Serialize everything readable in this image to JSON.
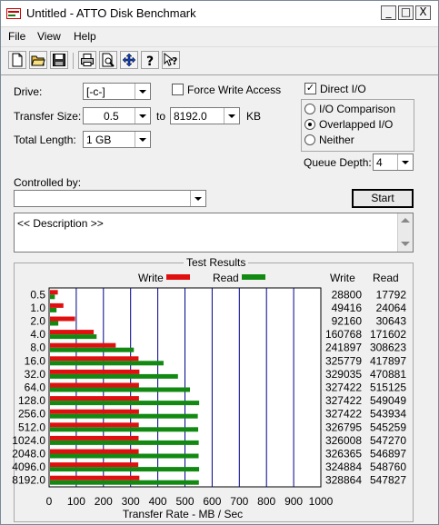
{
  "window": {
    "title": "Untitled - ATTO Disk Benchmark",
    "min": "_",
    "max": "□",
    "close": "X"
  },
  "menu": [
    "File",
    "View",
    "Help"
  ],
  "settings": {
    "drive_label": "Drive:",
    "drive_value": "[-c-]",
    "transfer_size_label": "Transfer Size:",
    "transfer_from": "0.5",
    "to_label": "to",
    "transfer_to": "8192.0",
    "kb_label": "KB",
    "total_length_label": "Total Length:",
    "total_length_value": "1 GB",
    "force_write_label": "Force Write Access",
    "force_write_checked": false,
    "direct_io_label": "Direct I/O",
    "direct_io_checked": true,
    "io_options": [
      {
        "label": "I/O Comparison",
        "selected": false
      },
      {
        "label": "Overlapped I/O",
        "selected": true
      },
      {
        "label": "Neither",
        "selected": false
      }
    ],
    "queue_depth_label": "Queue Depth:",
    "queue_depth_value": "4",
    "controlled_by_label": "Controlled by:",
    "controlled_by_value": "",
    "start_label": "Start",
    "description": "<< Description >>"
  },
  "results": {
    "group_title": "Test Results",
    "legend_write": "Write",
    "legend_read": "Read",
    "col_write": "Write",
    "col_read": "Read",
    "write_values_text": [
      "28800",
      "49416",
      "92160",
      "160768",
      "241897",
      "325779",
      "329035",
      "327422",
      "327422",
      "327422",
      "326795",
      "326008",
      "326365",
      "324884",
      "328864"
    ],
    "read_values_text": [
      "17792",
      "24064",
      "30643",
      "171602",
      "308623",
      "417897",
      "470881",
      "515125",
      "549049",
      "543934",
      "545259",
      "547270",
      "546897",
      "548760",
      "547827"
    ]
  },
  "colors": {
    "write": "#e01010",
    "read": "#128a12",
    "grid": "#00008b"
  },
  "chart_data": {
    "type": "bar",
    "orientation": "horizontal",
    "categories": [
      "0.5",
      "1.0",
      "2.0",
      "4.0",
      "8.0",
      "16.0",
      "32.0",
      "64.0",
      "128.0",
      "256.0",
      "512.0",
      "1024.0",
      "2048.0",
      "4096.0",
      "8192.0"
    ],
    "series": [
      {
        "name": "Write",
        "values": [
          28.8,
          49.4,
          92.2,
          160.8,
          241.9,
          325.8,
          329.0,
          327.4,
          327.4,
          327.4,
          326.8,
          326.0,
          326.4,
          324.9,
          328.9
        ]
      },
      {
        "name": "Read",
        "values": [
          17.8,
          24.1,
          30.6,
          171.6,
          308.6,
          417.9,
          470.9,
          515.1,
          549.0,
          543.9,
          545.3,
          547.3,
          546.9,
          548.8,
          547.8
        ]
      }
    ],
    "xlabel": "Transfer Rate - MB / Sec",
    "xticks": [
      "0",
      "100",
      "200",
      "300",
      "400",
      "500",
      "600",
      "700",
      "800",
      "900",
      "1000"
    ],
    "xlim": [
      0,
      1000
    ],
    "grid": true,
    "legend": "top"
  }
}
